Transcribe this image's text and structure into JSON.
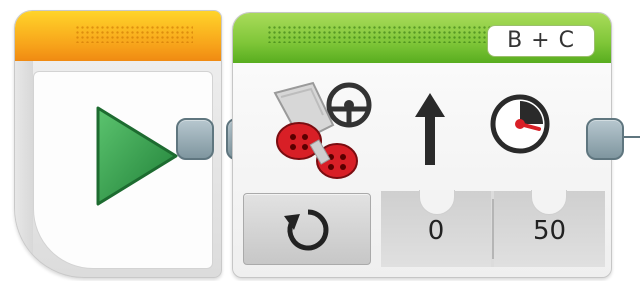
{
  "start_block": {
    "icon": "play-icon"
  },
  "move_block": {
    "port": "B + C",
    "mode_icon": "rotate-icon",
    "motor_icon": "move-steering-icon",
    "params": [
      {
        "icon": "steering-arrow-icon",
        "value": "0"
      },
      {
        "icon": "speedometer-icon",
        "value": "50"
      }
    ]
  },
  "colors": {
    "start_header": "#f7a21a",
    "move_header": "#7fc638",
    "play_green": "#2e9b4a",
    "motor_red": "#d81f26",
    "connector": "#7f969f"
  }
}
